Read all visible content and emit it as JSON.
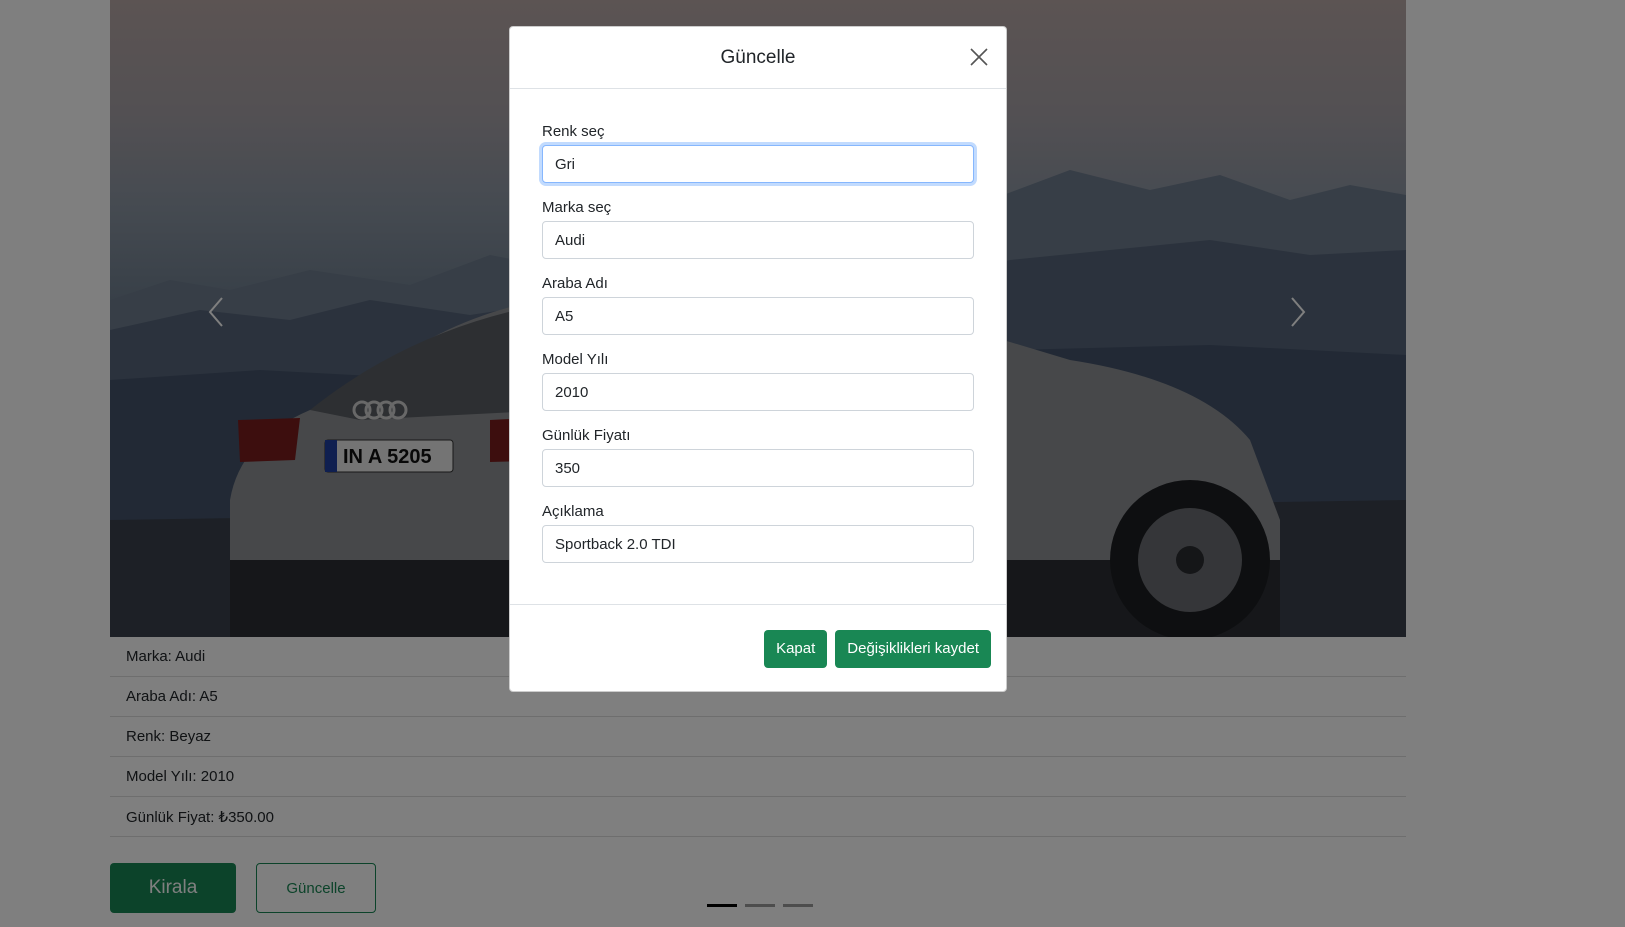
{
  "details": {
    "brand": "Marka: Audi",
    "car_name": "Araba Adı: A5",
    "color": "Renk: Beyaz",
    "model_year": "Model Yılı: 2010",
    "daily_price": "Günlük Fiyat: ₺350.00"
  },
  "actions": {
    "rent_label": "Kirala",
    "update_label": "Güncelle"
  },
  "carousel": {
    "slide_count": 3,
    "active_index": 0,
    "plate_text": "IN A 5205"
  },
  "modal": {
    "title": "Güncelle",
    "fields": {
      "color": {
        "label": "Renk seç",
        "value": "Gri"
      },
      "brand": {
        "label": "Marka seç",
        "value": "Audi"
      },
      "car_name": {
        "label": "Araba Adı",
        "value": "A5"
      },
      "model_year": {
        "label": "Model Yılı",
        "value": "2010"
      },
      "daily_price": {
        "label": "Günlük Fiyatı",
        "value": "350"
      },
      "description": {
        "label": "Açıklama",
        "value": "Sportback 2.0 TDI"
      }
    },
    "close_label": "Kapat",
    "save_label": "Değişiklikleri kaydet"
  },
  "colors": {
    "primary_green": "#198754",
    "focus_border": "#86b7fe"
  },
  "icons": {
    "prev": "chevron-left-icon",
    "next": "chevron-right-icon",
    "close": "close-icon"
  }
}
